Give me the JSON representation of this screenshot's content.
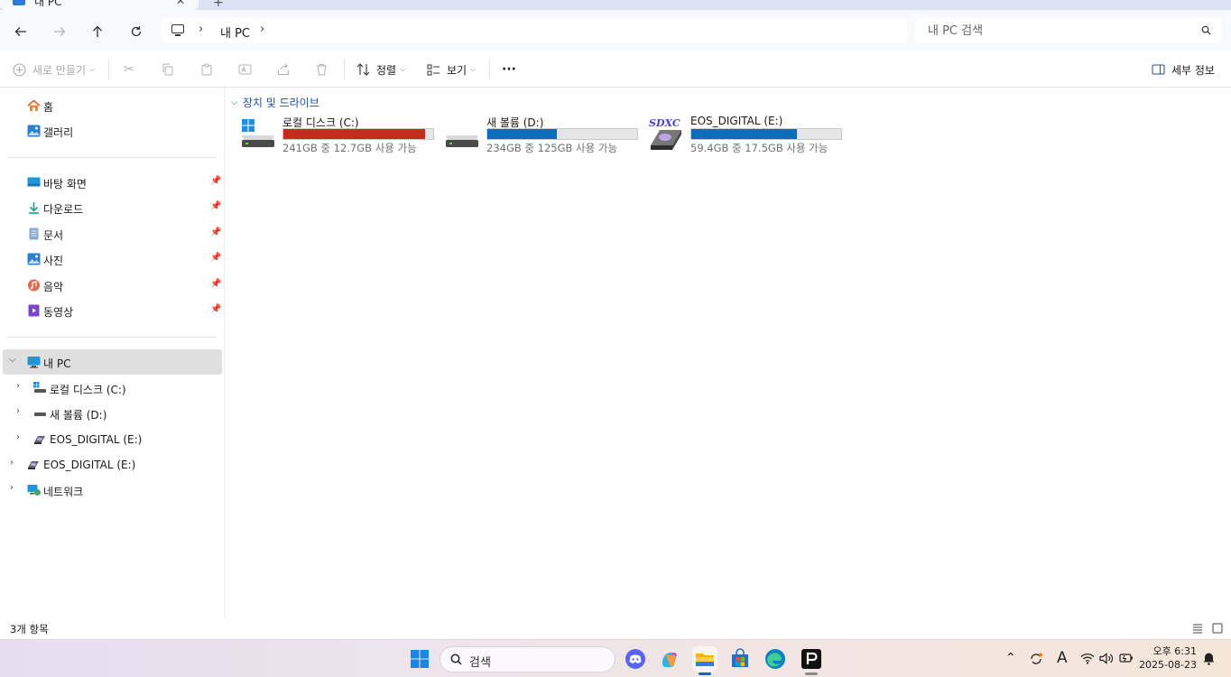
{
  "window": {
    "tab_title": "내 PC",
    "tab_close": "✕",
    "new_tab": "+"
  },
  "address": {
    "crumbs": [
      "내 PC"
    ],
    "search_placeholder": "내 PC 검색"
  },
  "toolbar": {
    "new_label": "새로 만들기",
    "sort_label": "정렬",
    "view_label": "보기",
    "more_label": "···",
    "details_label": "세부 정보"
  },
  "sidebar": {
    "home": "홈",
    "gallery": "갤러리",
    "quick_access": [
      {
        "label": "바탕 화면",
        "icon": "desktop-icon"
      },
      {
        "label": "다운로드",
        "icon": "download-icon"
      },
      {
        "label": "문서",
        "icon": "document-icon"
      },
      {
        "label": "사진",
        "icon": "pictures-icon"
      },
      {
        "label": "음악",
        "icon": "music-icon"
      },
      {
        "label": "동영상",
        "icon": "video-icon"
      }
    ],
    "this_pc": "내 PC",
    "this_pc_children": [
      {
        "label": "로컬 디스크 (C:)"
      },
      {
        "label": "새 볼륨 (D:)"
      },
      {
        "label": "EOS_DIGITAL (E:)"
      }
    ],
    "removable": "EOS_DIGITAL (E:)",
    "network": "네트워크"
  },
  "main": {
    "group_title": "장치 및 드라이브",
    "drives": [
      {
        "name": "로컬 디스크 (C:)",
        "free_text": "241GB 중 12.7GB 사용 가능",
        "used_fraction": 0.947,
        "bar_color": "#c42b1c",
        "icon": "windows-drive-icon"
      },
      {
        "name": "새 볼륨 (D:)",
        "free_text": "234GB 중 125GB 사용 가능",
        "used_fraction": 0.466,
        "bar_color": "#0f6cbd",
        "icon": "hard-drive-icon"
      },
      {
        "name": "EOS_DIGITAL (E:)",
        "free_text": "59.4GB 중 17.5GB 사용 가능",
        "used_fraction": 0.705,
        "bar_color": "#0f6cbd",
        "icon": "sdxc-card-icon"
      }
    ],
    "sdxc_logo": "SDXC"
  },
  "status": {
    "item_count": "3개 항목"
  },
  "taskbar": {
    "search_label": "검색",
    "clock_time": "오후 6:31",
    "clock_date": "2025-08-23",
    "ime_label": "A"
  }
}
